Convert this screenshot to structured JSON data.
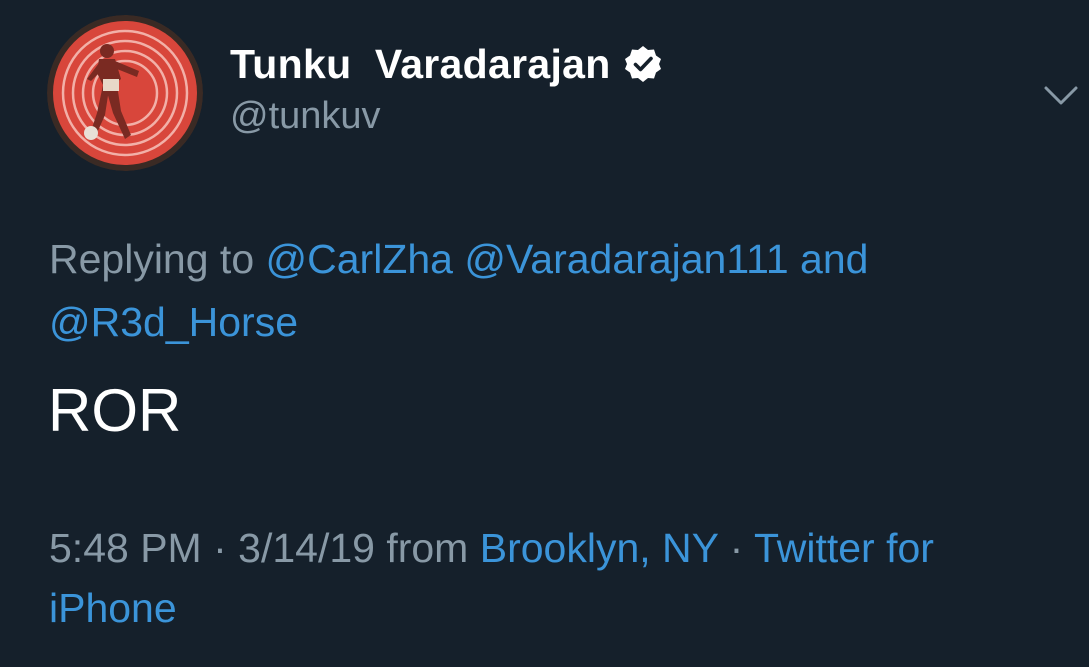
{
  "tweet": {
    "author": {
      "display_name": "Tunku  Varadarajan",
      "handle": "@tunkuv",
      "verified": true,
      "avatar_icon": "avatar-footballer-image"
    },
    "more_icon": "chevron-down-icon",
    "reply": {
      "prefix": "Replying to ",
      "mention_1": "@CarlZha",
      "mention_2": "@Varadarajan111",
      "conjunction": " and ",
      "mention_3": "@R3d_Horse"
    },
    "text": "ROR",
    "meta": {
      "time": "5:48 PM",
      "separator_1": " · ",
      "date": "3/14/19",
      "from": " from ",
      "location": "Brooklyn, NY",
      "separator_2": " · ",
      "source": "Twitter for iPhone"
    }
  },
  "colors": {
    "background": "#15202b",
    "text_primary": "#ffffff",
    "text_secondary": "#8899a6",
    "link": "#3b94d9",
    "avatar_red": "#d8463b"
  }
}
